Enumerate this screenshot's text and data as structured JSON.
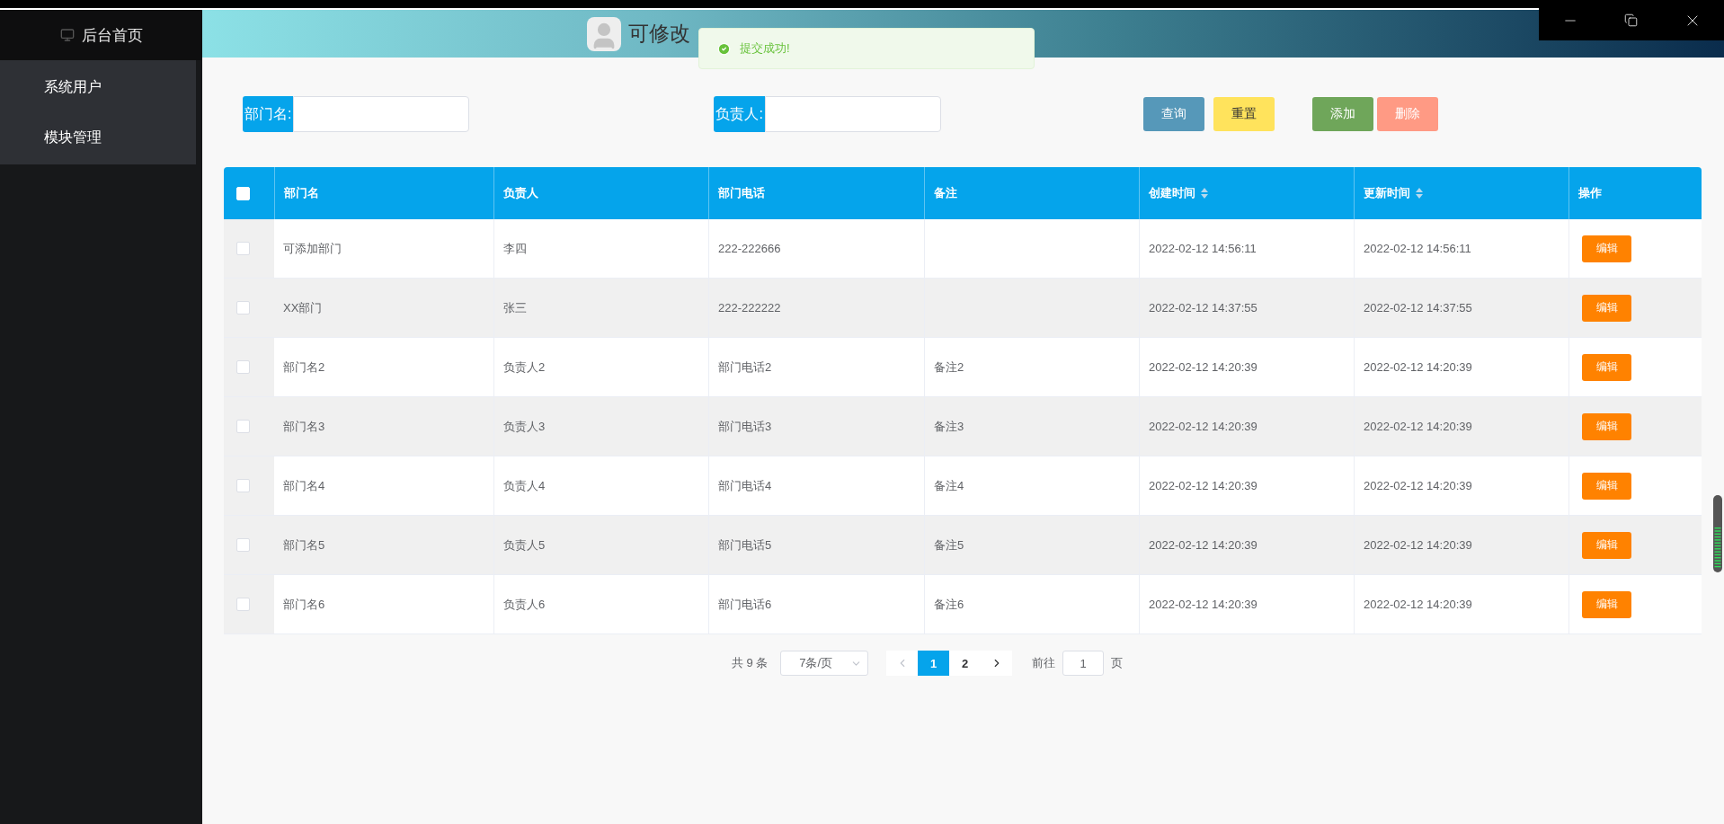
{
  "sidebar": {
    "home": "后台首页",
    "items": [
      {
        "label": "系统用户"
      },
      {
        "label": "模块管理"
      }
    ]
  },
  "header": {
    "title": "可修改"
  },
  "toast": {
    "message": "提交成功!"
  },
  "filters": [
    {
      "label": "部门名:"
    },
    {
      "label": "负责人:"
    }
  ],
  "buttons": [
    {
      "label": "查询",
      "kind": "query"
    },
    {
      "label": "重置",
      "kind": "reset"
    },
    {
      "label": "添加",
      "kind": "add"
    },
    {
      "label": "删除",
      "kind": "delete"
    }
  ],
  "table": {
    "select_all_checked": false,
    "columns": [
      {
        "label": "部门名"
      },
      {
        "label": "负责人"
      },
      {
        "label": "部门电话"
      },
      {
        "label": "备注"
      },
      {
        "label": "创建时间",
        "sortable": true
      },
      {
        "label": "更新时间",
        "sortable": true
      },
      {
        "label": "操作"
      }
    ],
    "rows": [
      {
        "checked": false,
        "cells": [
          "可添加部门",
          "李四",
          "222-222666",
          "",
          "2022-02-12 14:56:11",
          "2022-02-12 14:56:11"
        ],
        "action": "编辑"
      },
      {
        "checked": false,
        "cells": [
          "XX部门",
          "张三",
          "222-222222",
          "",
          "2022-02-12 14:37:55",
          "2022-02-12 14:37:55"
        ],
        "action": "编辑"
      },
      {
        "checked": false,
        "cells": [
          "部门名2",
          "负责人2",
          "部门电话2",
          "备注2",
          "2022-02-12 14:20:39",
          "2022-02-12 14:20:39"
        ],
        "action": "编辑"
      },
      {
        "checked": false,
        "cells": [
          "部门名3",
          "负责人3",
          "部门电话3",
          "备注3",
          "2022-02-12 14:20:39",
          "2022-02-12 14:20:39"
        ],
        "action": "编辑"
      },
      {
        "checked": false,
        "cells": [
          "部门名4",
          "负责人4",
          "部门电话4",
          "备注4",
          "2022-02-12 14:20:39",
          "2022-02-12 14:20:39"
        ],
        "action": "编辑"
      },
      {
        "checked": false,
        "cells": [
          "部门名5",
          "负责人5",
          "部门电话5",
          "备注5",
          "2022-02-12 14:20:39",
          "2022-02-12 14:20:39"
        ],
        "action": "编辑"
      },
      {
        "checked": false,
        "cells": [
          "部门名6",
          "负责人6",
          "部门电话6",
          "备注6",
          "2022-02-12 14:20:39",
          "2022-02-12 14:20:39"
        ],
        "action": "编辑"
      }
    ]
  },
  "pagination": {
    "total": "共 9 条",
    "page_size": "7条/页",
    "pages": [
      {
        "label": "1",
        "selected": true
      },
      {
        "label": "2",
        "selected": false
      }
    ],
    "goto_label": "前往",
    "goto_value": "1",
    "goto_suffix": "页"
  }
}
